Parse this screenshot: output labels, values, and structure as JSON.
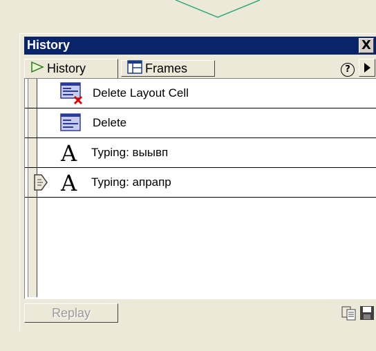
{
  "panel": {
    "title": "History",
    "close_label": "X",
    "tabs": [
      {
        "label": "History",
        "icon": "play-icon",
        "active": true
      },
      {
        "label": "Frames",
        "icon": "frames-icon",
        "active": false
      }
    ],
    "help_label": "?",
    "options_icon": "triangle-right-icon"
  },
  "history": {
    "items": [
      {
        "label": "Delete Layout Cell",
        "icon": "delete-layout-cell-icon"
      },
      {
        "label": "Delete",
        "icon": "delete-icon"
      },
      {
        "label": "Typing: выывп",
        "icon": "typing-icon"
      },
      {
        "label": "Typing: апрапр",
        "icon": "typing-icon",
        "current": true
      }
    ]
  },
  "footer": {
    "replay_label": "Replay",
    "copy_icon": "copy-steps-icon",
    "save_icon": "save-icon"
  },
  "colors": {
    "titlebar": "#0A246A",
    "panel_bg": "#ECE9D8",
    "delete_x": "#E00000",
    "layout_icon_blue": "#2A3A9A"
  }
}
